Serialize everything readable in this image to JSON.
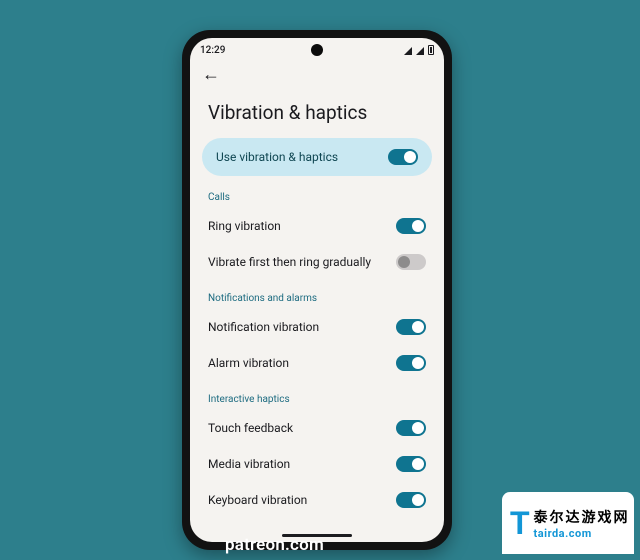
{
  "statusbar": {
    "time": "12:29"
  },
  "page": {
    "title": "Vibration & haptics",
    "master": {
      "label": "Use vibration & haptics",
      "on": true
    }
  },
  "sections": {
    "calls": {
      "label": "Calls",
      "items": [
        {
          "label": "Ring vibration",
          "on": true
        },
        {
          "label": "Vibrate first then ring gradually",
          "on": false
        }
      ]
    },
    "notifications": {
      "label": "Notifications and alarms",
      "items": [
        {
          "label": "Notification vibration",
          "on": true
        },
        {
          "label": "Alarm vibration",
          "on": true
        }
      ]
    },
    "interactive": {
      "label": "Interactive haptics",
      "items": [
        {
          "label": "Touch feedback",
          "on": true
        },
        {
          "label": "Media vibration",
          "on": true
        },
        {
          "label": "Keyboard vibration",
          "on": true
        }
      ]
    }
  },
  "footer": {
    "text": "patreon.com"
  },
  "brand": {
    "glyph": "T",
    "cn": "泰尔达游戏网",
    "domain": "tairda.com"
  }
}
